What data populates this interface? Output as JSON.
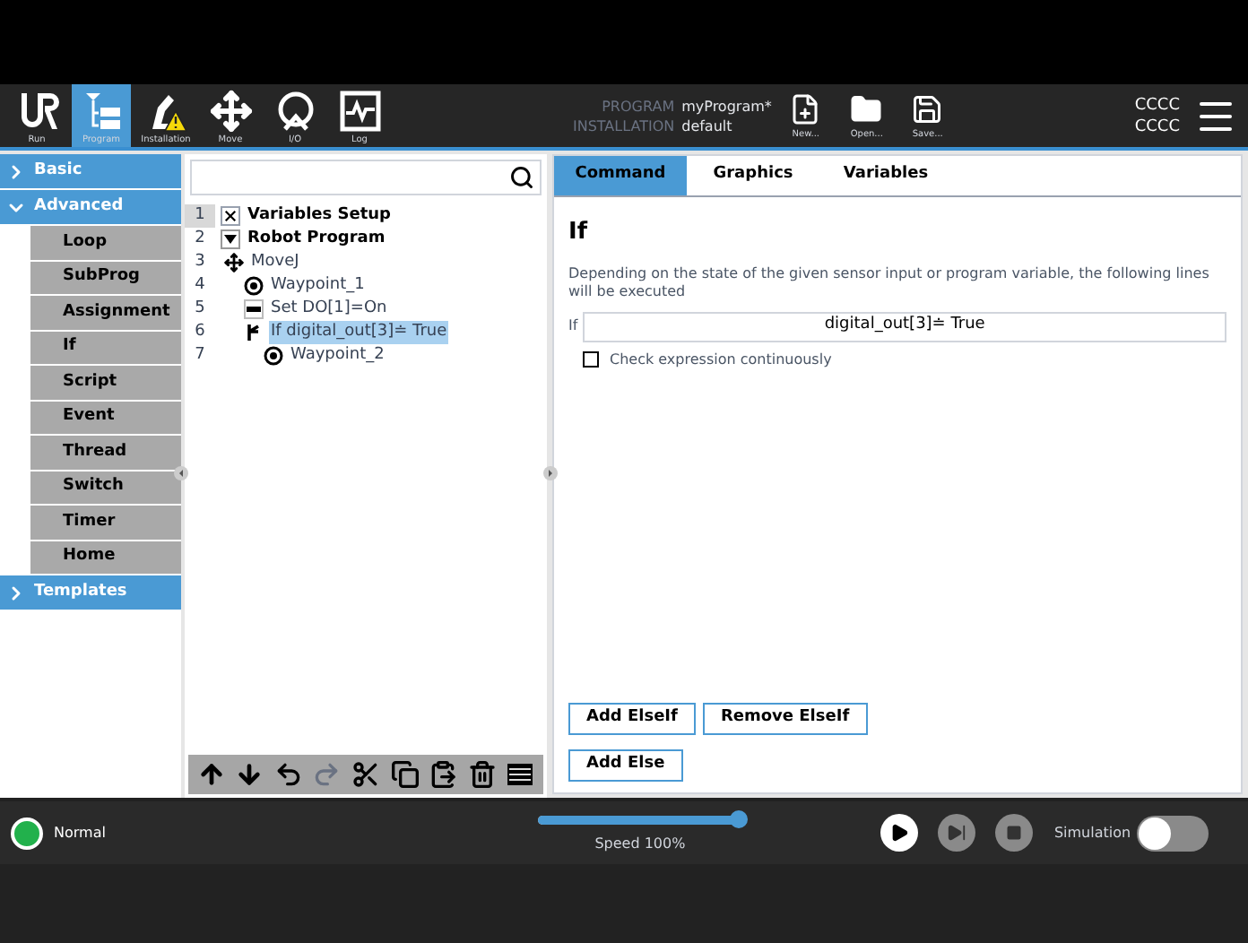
{
  "header": {
    "nav_tabs": [
      {
        "label": "Run",
        "kind": "run",
        "selected": false
      },
      {
        "label": "Program",
        "kind": "program",
        "selected": true
      },
      {
        "label": "Installation",
        "kind": "installation",
        "selected": false
      },
      {
        "label": "Move",
        "kind": "move",
        "selected": false
      },
      {
        "label": "I/O",
        "kind": "io",
        "selected": false
      },
      {
        "label": "Log",
        "kind": "log",
        "selected": false
      }
    ],
    "program_label": "PROGRAM",
    "program_name": "myProgram*",
    "installation_label": "INSTALLATION",
    "installation_name": "default",
    "file_buttons": [
      {
        "label": "New...",
        "kind": "new"
      },
      {
        "label": "Open...",
        "kind": "open"
      },
      {
        "label": "Save...",
        "kind": "save"
      }
    ],
    "status_codes": [
      "CCCC",
      "CCCC"
    ]
  },
  "sidebar": {
    "categories": [
      {
        "label": "Basic",
        "expanded": false
      },
      {
        "label": "Advanced",
        "expanded": true,
        "children": [
          {
            "label": "Loop"
          },
          {
            "label": "SubProg"
          },
          {
            "label": "Assignment"
          },
          {
            "label": "If"
          },
          {
            "label": "Script"
          },
          {
            "label": "Event"
          },
          {
            "label": "Thread"
          },
          {
            "label": "Switch"
          },
          {
            "label": "Timer"
          },
          {
            "label": "Home"
          }
        ]
      },
      {
        "label": "Templates",
        "expanded": false
      }
    ]
  },
  "tree": {
    "nodes": [
      {
        "number": "1",
        "label": "Variables Setup",
        "kind": "variables",
        "selected": false
      },
      {
        "number": "2",
        "label": "Robot Program",
        "kind": "root",
        "selected": false,
        "children": [
          {
            "number": "3",
            "label": "MoveJ",
            "kind": "move",
            "selected": false,
            "children": [
              {
                "number": "4",
                "label": "Waypoint_1",
                "kind": "waypoint",
                "selected": false
              },
              {
                "number": "5",
                "label": "Set DO[1]=On",
                "kind": "set",
                "selected": false
              },
              {
                "number": "6",
                "label": "If digital_out[3]≐ True",
                "kind": "if",
                "selected": true,
                "children": [
                  {
                    "number": "7",
                    "label": "Waypoint_2",
                    "kind": "waypoint",
                    "selected": false
                  }
                ]
              }
            ]
          }
        ]
      }
    ]
  },
  "command": {
    "tabs": [
      {
        "label": "Command",
        "selected": true
      },
      {
        "label": "Graphics",
        "selected": false
      },
      {
        "label": "Variables",
        "selected": false
      }
    ],
    "title": "If",
    "description": "Depending on the state of the given sensor input or program variable, the following lines will be executed",
    "if_label": "If",
    "expression": "digital_out[3]≐ True",
    "check": {
      "label": "Check expression continuously",
      "checked": false
    },
    "buttons": [
      [
        "Add ElseIf",
        "Remove ElseIf"
      ],
      [
        "Add Else"
      ]
    ]
  },
  "footer": {
    "status": {
      "label": "Normal",
      "color": "#22b14c"
    },
    "speed": {
      "level": 1,
      "reading": "Speed 100%"
    },
    "simulation": {
      "label": "Simulation",
      "on": false
    }
  }
}
